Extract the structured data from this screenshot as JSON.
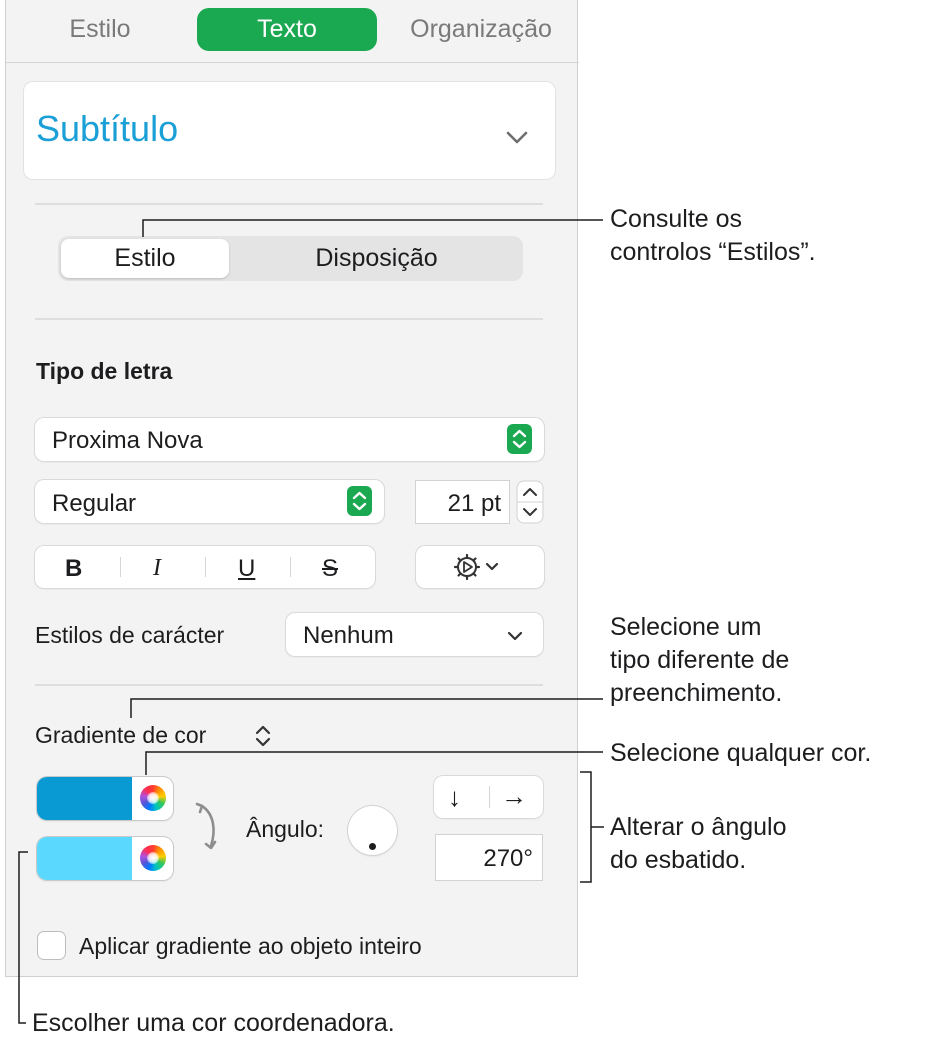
{
  "tabs": [
    {
      "label": "Estilo",
      "active": false
    },
    {
      "label": "Texto",
      "active": true
    },
    {
      "label": "Organização",
      "active": false
    }
  ],
  "paragraph_style": {
    "name": "Subtítulo"
  },
  "segmented": {
    "style_label": "Estilo",
    "layout_label": "Disposição",
    "selected": "Estilo"
  },
  "font": {
    "section_title": "Tipo de letra",
    "family": "Proxima Nova",
    "typeface": "Regular",
    "size": "21 pt",
    "bold": "B",
    "italic": "I",
    "underline": "U",
    "strikethrough": "S"
  },
  "char_styles": {
    "label": "Estilos de carácter",
    "value": "Nenhum"
  },
  "fill": {
    "type": "Gradiente de cor",
    "color1": "#0a9ad3",
    "color2": "#5ad8fd",
    "angle_label": "Ângulo:",
    "angle_value": "270°",
    "angle_degrees": 270,
    "down_arrow": "↓",
    "right_arrow": "→",
    "checkbox_label": "Aplicar gradiente ao objeto inteiro",
    "checkbox_checked": false
  },
  "callouts": {
    "styles_line1": "Consulte os",
    "styles_line2": "controlos “Estilos”.",
    "fill_line1": "Selecione um",
    "fill_line2": "tipo diferente de",
    "fill_line3": "preenchimento.",
    "any_color": "Selecione qualquer cor.",
    "angle_line1": "Alterar o ângulo",
    "angle_line2": "do esbatido.",
    "coordinating": "Escolher uma cor coordenadora."
  },
  "colors": {
    "accent_green": "#1aa851",
    "subtitle_blue": "#1a9fd6",
    "panel_bg": "#f3f3f3"
  },
  "icons": [
    "chevron-down-icon",
    "stepper-icon",
    "gear-options-icon",
    "swap-colors-icon",
    "color-wheel-icon",
    "down-arrow-icon",
    "right-arrow-icon"
  ]
}
